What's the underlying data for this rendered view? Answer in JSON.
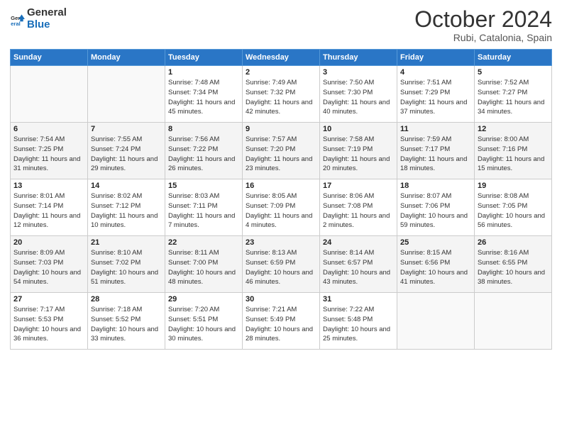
{
  "logo": {
    "text_general": "General",
    "text_blue": "Blue"
  },
  "header": {
    "month": "October 2024",
    "location": "Rubi, Catalonia, Spain"
  },
  "weekdays": [
    "Sunday",
    "Monday",
    "Tuesday",
    "Wednesday",
    "Thursday",
    "Friday",
    "Saturday"
  ],
  "weeks": [
    [
      {
        "day": "",
        "info": ""
      },
      {
        "day": "",
        "info": ""
      },
      {
        "day": "1",
        "info": "Sunrise: 7:48 AM\nSunset: 7:34 PM\nDaylight: 11 hours and 45 minutes."
      },
      {
        "day": "2",
        "info": "Sunrise: 7:49 AM\nSunset: 7:32 PM\nDaylight: 11 hours and 42 minutes."
      },
      {
        "day": "3",
        "info": "Sunrise: 7:50 AM\nSunset: 7:30 PM\nDaylight: 11 hours and 40 minutes."
      },
      {
        "day": "4",
        "info": "Sunrise: 7:51 AM\nSunset: 7:29 PM\nDaylight: 11 hours and 37 minutes."
      },
      {
        "day": "5",
        "info": "Sunrise: 7:52 AM\nSunset: 7:27 PM\nDaylight: 11 hours and 34 minutes."
      }
    ],
    [
      {
        "day": "6",
        "info": "Sunrise: 7:54 AM\nSunset: 7:25 PM\nDaylight: 11 hours and 31 minutes."
      },
      {
        "day": "7",
        "info": "Sunrise: 7:55 AM\nSunset: 7:24 PM\nDaylight: 11 hours and 29 minutes."
      },
      {
        "day": "8",
        "info": "Sunrise: 7:56 AM\nSunset: 7:22 PM\nDaylight: 11 hours and 26 minutes."
      },
      {
        "day": "9",
        "info": "Sunrise: 7:57 AM\nSunset: 7:20 PM\nDaylight: 11 hours and 23 minutes."
      },
      {
        "day": "10",
        "info": "Sunrise: 7:58 AM\nSunset: 7:19 PM\nDaylight: 11 hours and 20 minutes."
      },
      {
        "day": "11",
        "info": "Sunrise: 7:59 AM\nSunset: 7:17 PM\nDaylight: 11 hours and 18 minutes."
      },
      {
        "day": "12",
        "info": "Sunrise: 8:00 AM\nSunset: 7:16 PM\nDaylight: 11 hours and 15 minutes."
      }
    ],
    [
      {
        "day": "13",
        "info": "Sunrise: 8:01 AM\nSunset: 7:14 PM\nDaylight: 11 hours and 12 minutes."
      },
      {
        "day": "14",
        "info": "Sunrise: 8:02 AM\nSunset: 7:12 PM\nDaylight: 11 hours and 10 minutes."
      },
      {
        "day": "15",
        "info": "Sunrise: 8:03 AM\nSunset: 7:11 PM\nDaylight: 11 hours and 7 minutes."
      },
      {
        "day": "16",
        "info": "Sunrise: 8:05 AM\nSunset: 7:09 PM\nDaylight: 11 hours and 4 minutes."
      },
      {
        "day": "17",
        "info": "Sunrise: 8:06 AM\nSunset: 7:08 PM\nDaylight: 11 hours and 2 minutes."
      },
      {
        "day": "18",
        "info": "Sunrise: 8:07 AM\nSunset: 7:06 PM\nDaylight: 10 hours and 59 minutes."
      },
      {
        "day": "19",
        "info": "Sunrise: 8:08 AM\nSunset: 7:05 PM\nDaylight: 10 hours and 56 minutes."
      }
    ],
    [
      {
        "day": "20",
        "info": "Sunrise: 8:09 AM\nSunset: 7:03 PM\nDaylight: 10 hours and 54 minutes."
      },
      {
        "day": "21",
        "info": "Sunrise: 8:10 AM\nSunset: 7:02 PM\nDaylight: 10 hours and 51 minutes."
      },
      {
        "day": "22",
        "info": "Sunrise: 8:11 AM\nSunset: 7:00 PM\nDaylight: 10 hours and 48 minutes."
      },
      {
        "day": "23",
        "info": "Sunrise: 8:13 AM\nSunset: 6:59 PM\nDaylight: 10 hours and 46 minutes."
      },
      {
        "day": "24",
        "info": "Sunrise: 8:14 AM\nSunset: 6:57 PM\nDaylight: 10 hours and 43 minutes."
      },
      {
        "day": "25",
        "info": "Sunrise: 8:15 AM\nSunset: 6:56 PM\nDaylight: 10 hours and 41 minutes."
      },
      {
        "day": "26",
        "info": "Sunrise: 8:16 AM\nSunset: 6:55 PM\nDaylight: 10 hours and 38 minutes."
      }
    ],
    [
      {
        "day": "27",
        "info": "Sunrise: 7:17 AM\nSunset: 5:53 PM\nDaylight: 10 hours and 36 minutes."
      },
      {
        "day": "28",
        "info": "Sunrise: 7:18 AM\nSunset: 5:52 PM\nDaylight: 10 hours and 33 minutes."
      },
      {
        "day": "29",
        "info": "Sunrise: 7:20 AM\nSunset: 5:51 PM\nDaylight: 10 hours and 30 minutes."
      },
      {
        "day": "30",
        "info": "Sunrise: 7:21 AM\nSunset: 5:49 PM\nDaylight: 10 hours and 28 minutes."
      },
      {
        "day": "31",
        "info": "Sunrise: 7:22 AM\nSunset: 5:48 PM\nDaylight: 10 hours and 25 minutes."
      },
      {
        "day": "",
        "info": ""
      },
      {
        "day": "",
        "info": ""
      }
    ]
  ]
}
